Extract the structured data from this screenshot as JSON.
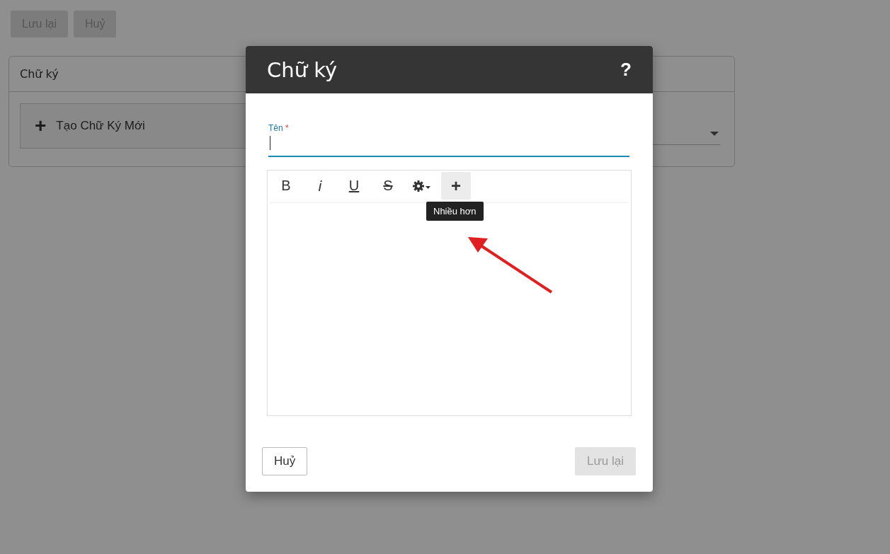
{
  "page_toolbar": [
    {
      "label": "Lưu lại",
      "disabled": true
    },
    {
      "label": "Huỷ",
      "disabled": true
    }
  ],
  "card": {
    "title": "Chữ ký",
    "new_button": {
      "icon": "+",
      "label": "Tạo Chữ Ký Mới"
    }
  },
  "dialog": {
    "title": "Chữ ký",
    "help": "?",
    "name_field": {
      "label": "Tên",
      "required": "*"
    },
    "editor_toolbar": [
      {
        "kind": "bold",
        "label": "B",
        "hovered": false
      },
      {
        "kind": "italic",
        "label": "i",
        "hovered": false
      },
      {
        "kind": "underline",
        "label": "U",
        "hovered": false
      },
      {
        "kind": "strike",
        "label": "S",
        "hovered": false
      },
      {
        "kind": "settings",
        "hovered": false
      },
      {
        "kind": "more",
        "label": "+",
        "hovered": true,
        "tooltip": "Nhiều hơn"
      }
    ],
    "buttons": [
      {
        "label": "Huỷ",
        "disabled": false
      },
      {
        "label": "Lưu lại",
        "disabled": true
      }
    ]
  }
}
